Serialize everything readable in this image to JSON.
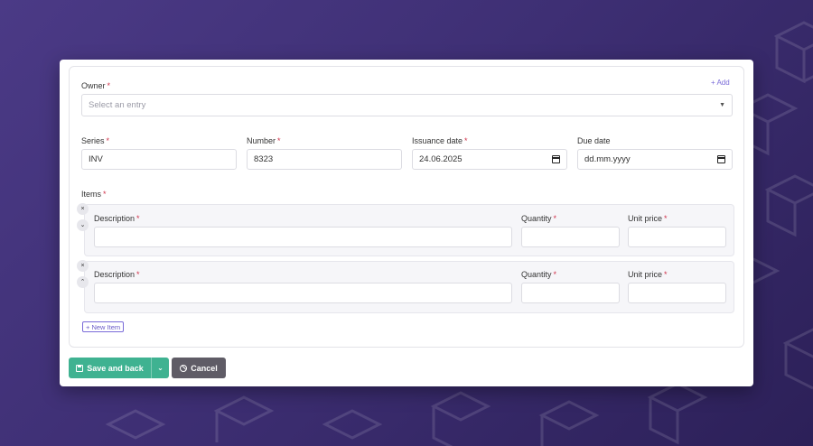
{
  "form": {
    "owner": {
      "label": "Owner",
      "required": "*",
      "placeholder": "Select an entry",
      "add_label": "+ Add"
    },
    "series": {
      "label": "Series",
      "required": "*",
      "value": "INV"
    },
    "number": {
      "label": "Number",
      "required": "*",
      "value": "8323"
    },
    "issuance_date": {
      "label": "Issuance date",
      "required": "*",
      "value": "24.06.2025"
    },
    "due_date": {
      "label": "Due date",
      "value": "dd.mm.yyyy"
    },
    "items_label": "Items",
    "items_required": "*",
    "items": [
      {
        "description_label": "Description",
        "quantity_label": "Quantity",
        "unit_price_label": "Unit price",
        "required": "*",
        "remove_glyph": "×",
        "move_glyph": "⌄"
      },
      {
        "description_label": "Description",
        "quantity_label": "Quantity",
        "unit_price_label": "Unit price",
        "required": "*",
        "remove_glyph": "×",
        "move_glyph": "⌃"
      }
    ],
    "new_item_label": "+ New Item"
  },
  "actions": {
    "save_label": "Save and back",
    "save_dropdown_glyph": "⌄",
    "cancel_label": "Cancel"
  },
  "icons": {
    "owner_select": "chevron-down-icon",
    "date_picker": "calendar-icon",
    "save": "floppy-disk-icon",
    "cancel": "ban-icon"
  },
  "colors": {
    "accent": "#7a6bd8",
    "save_button": "#3fb291",
    "cancel_button": "#5f5c66",
    "required": "#d0334b"
  }
}
